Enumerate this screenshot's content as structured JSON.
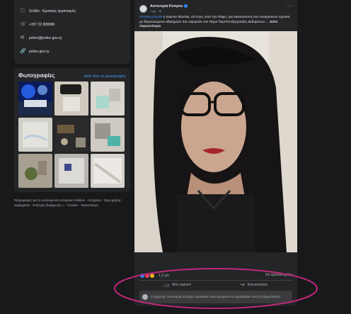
{
  "about": {
    "category": "Σελίδα · Κρατικός οργανισμός",
    "phone": "+357 22 808080",
    "email": "police@police.gov.cy",
    "website": "police.gov.cy"
  },
  "photos": {
    "title": "Φωτογραφίες",
    "see_all": "Δείτε όλες τις φωτογραφίες"
  },
  "footer": "Πληροφορίες για τη συσσώρευση στοιχείων Σελίδων · Απόρρητο · Όροι χρήσης · Διαφημίσεις · Επιλογές διαφήμισης ▷ · Cookies · Περισσότερα",
  "post": {
    "author": "Αστυνομία Κύπρου",
    "time": "1 ημ. · ⊕",
    "more": "···",
    "hashtag": "#ΚαταζητείταιΝ",
    "text": " η Ιωάννα Φουτάκ, 43 ετών, από την Πάφο, για διευκόλυνση των ανακρίσεων σχετικά με διερευνώμενα αδικήματα που αφορούν τον Νόμο Περί Επεξεργασίας Δεδομένων ...",
    "see_more": "Δείτε περισσότερα",
    "reactions_count": "1,3 χιλ.",
    "comments_count": "54 σχόλια/σχόλια",
    "like_label": "Μου αρέσει!",
    "share_label": "Κοινοποίηση",
    "notice": "Ο χρήστης Αστυνομία Κύπρου περιόρισε ποιοι μπορούν να σχολιάζουν αυτή τη δημοσίευση."
  },
  "colors": {
    "background": "#18191a",
    "card": "#242526",
    "link": "#4599ff",
    "annotation": "#c0287c"
  }
}
